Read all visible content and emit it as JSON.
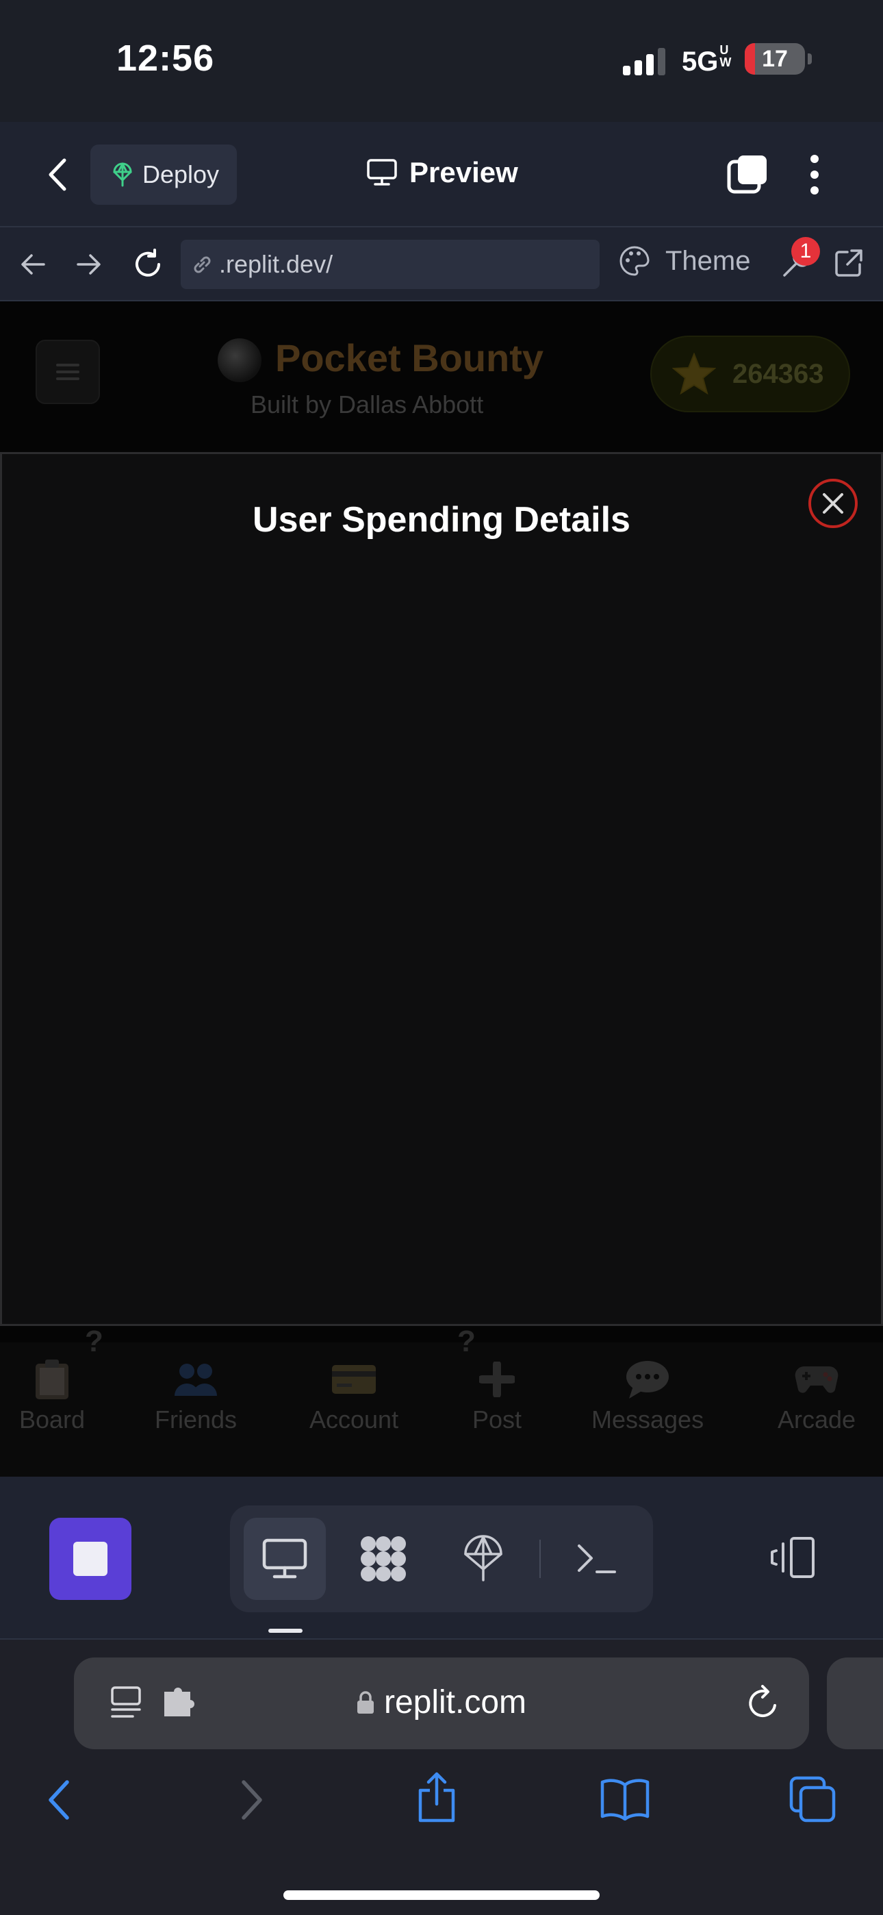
{
  "status_bar": {
    "time": "12:56",
    "network": "5G",
    "network_suffix": "UW",
    "battery": "17",
    "battery_level": 0.17
  },
  "replit_header": {
    "deploy_label": "Deploy",
    "preview_label": "Preview"
  },
  "url_bar": {
    "url": ".replit.dev/",
    "theme_label": "Theme",
    "notification_count": "1"
  },
  "app": {
    "title": "Pocket Bounty",
    "subtitle": "Built by Dallas Abbott",
    "points": "264363",
    "modal": {
      "title": "User Spending Details"
    },
    "nav": [
      {
        "label": "Board",
        "icon": "clipboard-icon"
      },
      {
        "label": "Friends",
        "icon": "people-icon"
      },
      {
        "label": "Account",
        "icon": "credit-card-icon"
      },
      {
        "label": "Post",
        "icon": "plus-icon"
      },
      {
        "label": "Messages",
        "icon": "speech-bubble-icon"
      },
      {
        "label": "Arcade",
        "icon": "game-controller-icon"
      }
    ],
    "partial_marks": [
      "?",
      "?"
    ]
  },
  "replit_toolbar": {
    "views": [
      "preview-icon",
      "apps-icon",
      "deploy-icon",
      "shell-icon"
    ],
    "colors": {
      "stop": "#5a3fd6"
    }
  },
  "safari": {
    "domain": "replit.com"
  }
}
